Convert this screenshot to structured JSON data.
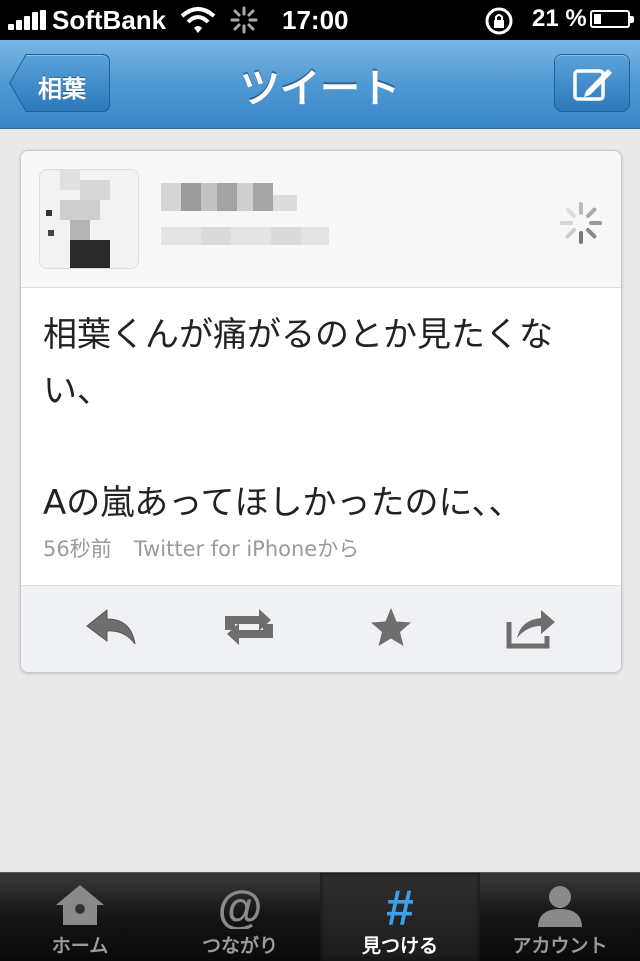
{
  "status_bar": {
    "carrier": "SoftBank",
    "time": "17:00",
    "battery_percent": "21 %",
    "battery_level": 0.21
  },
  "nav": {
    "back_label": "相葉",
    "title": "ツイート"
  },
  "tweet": {
    "text": "相葉くんが痛がるのとか見たくない、\n\nAの嵐あってほしかったのに、、",
    "time_ago": "56秒前",
    "client": "Twitter for iPhoneから"
  },
  "actions": [
    {
      "icon": "reply-icon"
    },
    {
      "icon": "retweet-icon"
    },
    {
      "icon": "star-icon"
    },
    {
      "icon": "share-icon"
    }
  ],
  "tabs": [
    {
      "label": "ホーム",
      "icon": "home-icon"
    },
    {
      "label": "つながり",
      "icon": "at-icon"
    },
    {
      "label": "見つける",
      "icon": "hashtag-icon"
    },
    {
      "label": "アカウント",
      "icon": "person-icon"
    }
  ],
  "selected_tab": "見つける",
  "colors": {
    "nav_blue": "#4f99d3",
    "hashtag_blue": "#3aa0e8"
  }
}
